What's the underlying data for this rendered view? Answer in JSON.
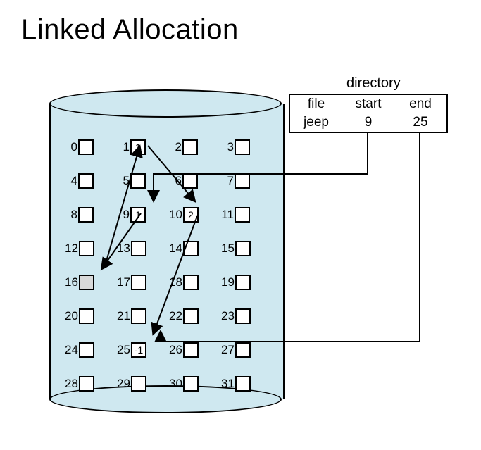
{
  "title": "Linked Allocation",
  "directory": {
    "label": "directory",
    "headers": {
      "file": "file",
      "start": "start",
      "end": "end"
    },
    "row": {
      "file": "jeep",
      "start": "9",
      "end": "25"
    }
  },
  "disk": {
    "rows": 8,
    "cols": 4,
    "blocks": [
      {
        "n": "0",
        "v": ""
      },
      {
        "n": "1",
        "v": "1"
      },
      {
        "n": "2",
        "v": ""
      },
      {
        "n": "3",
        "v": ""
      },
      {
        "n": "4",
        "v": ""
      },
      {
        "n": "5",
        "v": ""
      },
      {
        "n": "6",
        "v": ""
      },
      {
        "n": "7",
        "v": ""
      },
      {
        "n": "8",
        "v": ""
      },
      {
        "n": "9",
        "v": "1"
      },
      {
        "n": "10",
        "v": "2"
      },
      {
        "n": "11",
        "v": ""
      },
      {
        "n": "12",
        "v": ""
      },
      {
        "n": "13",
        "v": ""
      },
      {
        "n": "14",
        "v": ""
      },
      {
        "n": "15",
        "v": ""
      },
      {
        "n": "16",
        "v": "",
        "shaded": true
      },
      {
        "n": "17",
        "v": ""
      },
      {
        "n": "18",
        "v": ""
      },
      {
        "n": "19",
        "v": ""
      },
      {
        "n": "20",
        "v": ""
      },
      {
        "n": "21",
        "v": ""
      },
      {
        "n": "22",
        "v": ""
      },
      {
        "n": "23",
        "v": ""
      },
      {
        "n": "24",
        "v": ""
      },
      {
        "n": "25",
        "v": "-1"
      },
      {
        "n": "26",
        "v": ""
      },
      {
        "n": "27",
        "v": ""
      },
      {
        "n": "28",
        "v": ""
      },
      {
        "n": "29",
        "v": ""
      },
      {
        "n": "30",
        "v": ""
      },
      {
        "n": "31",
        "v": ""
      }
    ]
  },
  "links": {
    "description": "File 'jeep' chain: 9 → 16 → 1 → 10 → 25 (-1 end)",
    "chain": [
      9,
      16,
      1,
      10,
      25
    ]
  }
}
